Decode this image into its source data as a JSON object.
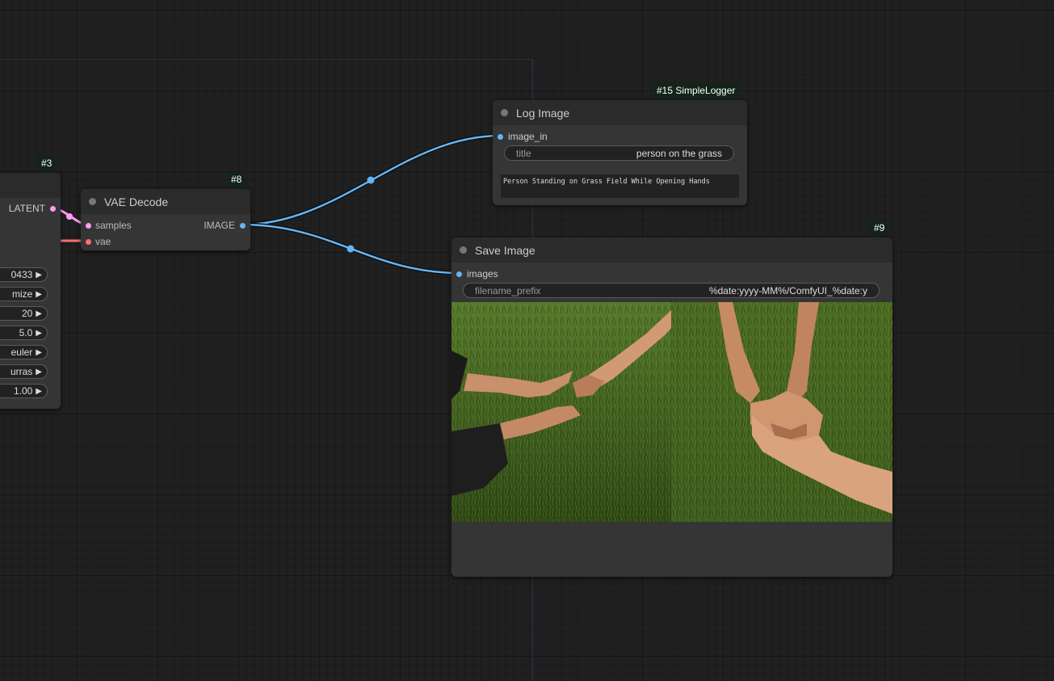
{
  "nodes": {
    "ksampler": {
      "badge": "#3",
      "output_label": "LATENT",
      "widgets": [
        {
          "value": "0433"
        },
        {
          "value": "mize"
        },
        {
          "value": "20"
        },
        {
          "value": "5.0"
        },
        {
          "value": "euler"
        },
        {
          "value": "urras"
        },
        {
          "value": "1.00"
        }
      ]
    },
    "vae_decode": {
      "badge": "#8",
      "title": "VAE Decode",
      "inputs": {
        "samples": "samples",
        "vae": "vae"
      },
      "output": "IMAGE"
    },
    "log_image": {
      "badge": "#15 SimpleLogger",
      "title": "Log Image",
      "input": "image_in",
      "title_widget": {
        "label": "title",
        "value": "person on the grass"
      },
      "text": "Person Standing on Grass Field While Opening Hands"
    },
    "save_image": {
      "badge": "#9",
      "title": "Save Image",
      "input": "images",
      "filename_widget": {
        "label": "filename_prefix",
        "value": "%date:yyyy-MM%/ComfyUI_%date:y"
      },
      "preview": "two pairs of hands cupped over green grass"
    }
  },
  "colors": {
    "latent": "#ff9cf9",
    "vae": "#ff6e6e",
    "image": "#64b5f6",
    "background": "#202020",
    "node_body": "#353535",
    "node_header": "#2b2b2b"
  }
}
